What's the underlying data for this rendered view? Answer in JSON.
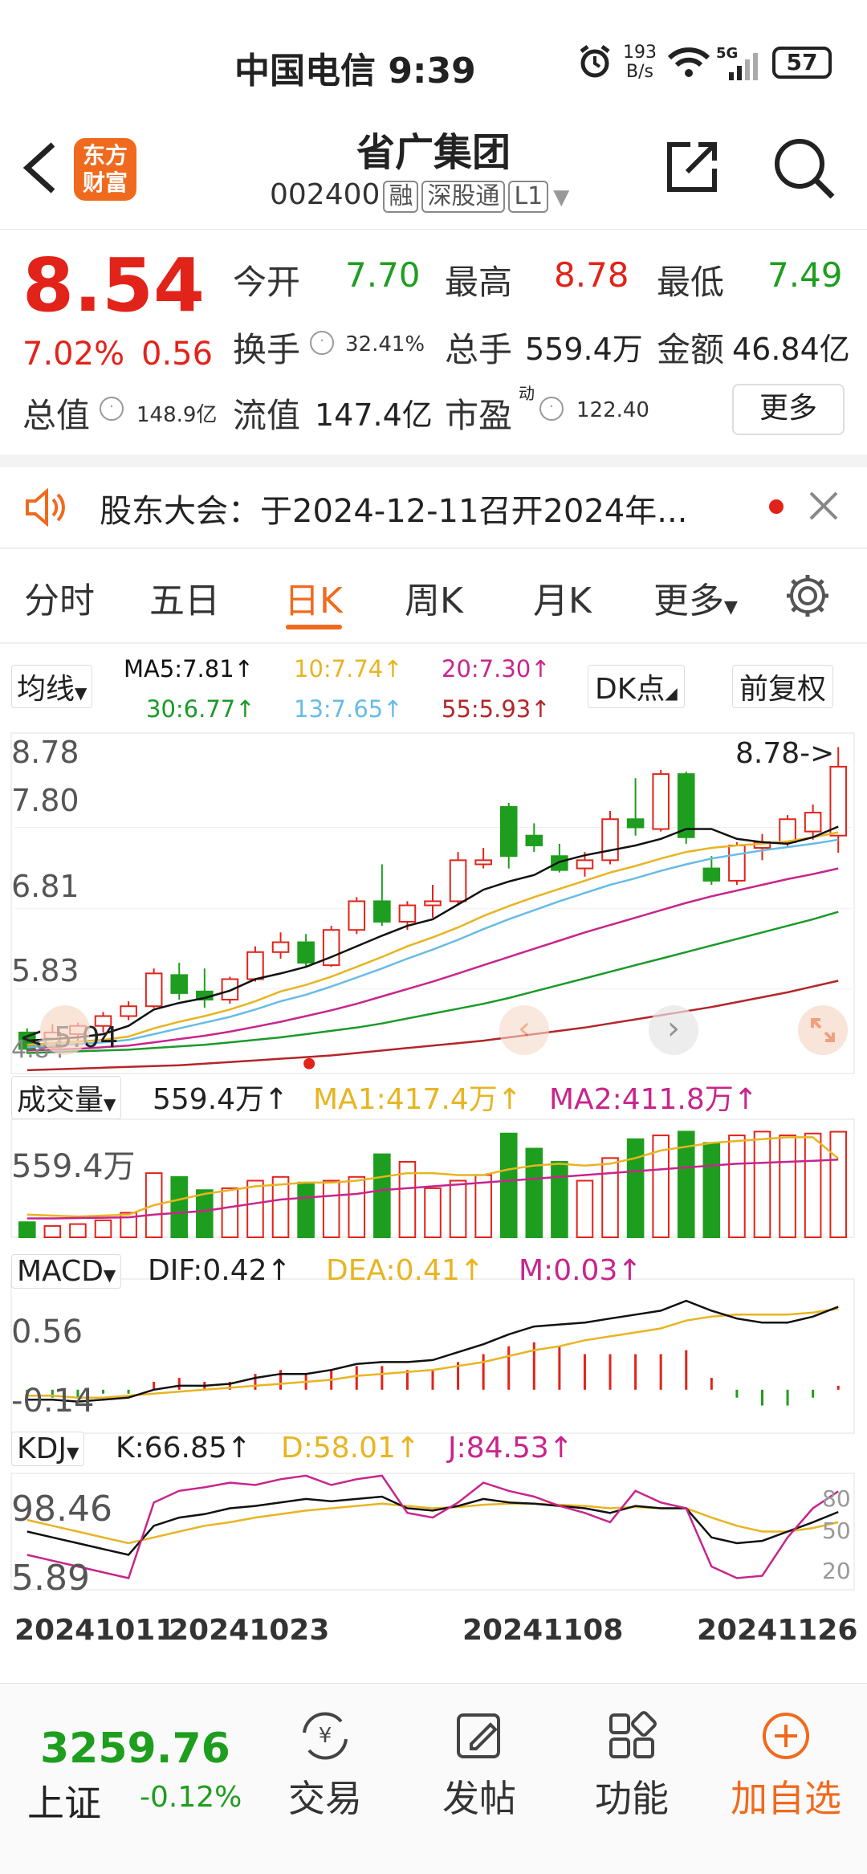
{
  "status_bar": {
    "carrier_time": "中国电信 9:39",
    "net_speed_top": "193",
    "net_speed_unit": "B/s",
    "signal_label": "5G",
    "battery": "57"
  },
  "header": {
    "title": "省广集团",
    "code": "002400",
    "tags": [
      "融",
      "深股通",
      "L1"
    ],
    "logo_line1": "东方",
    "logo_line2": "财富"
  },
  "quote": {
    "price": "8.54",
    "change_pct": "7.02%",
    "change_amt": "0.56",
    "open_label": "今开",
    "open": "7.70",
    "high_label": "最高",
    "high": "8.78",
    "low_label": "最低",
    "low": "7.49",
    "turnover_label": "换手",
    "turnover": "32.41%",
    "volume_label": "总手",
    "volume": "559.4万",
    "amount_label": "金额",
    "amount": "46.84亿",
    "mktcap_label": "总值",
    "mktcap": "148.9亿",
    "float_label": "流值",
    "float_cap": "147.4亿",
    "pe_label": "市盈",
    "pe_sup": "动",
    "pe": "122.40",
    "more_label": "更多"
  },
  "notice": {
    "text": "股东大会：于2024-12-11召开2024年..."
  },
  "tabs": {
    "items": [
      "分时",
      "五日",
      "日K",
      "周K",
      "月K",
      "更多"
    ],
    "active": 2
  },
  "ma_legend": {
    "selector": "均线",
    "ma5": "MA5:7.81↑",
    "ma10": "10:7.74↑",
    "ma20": "20:7.30↑",
    "ma30": "30:6.77↑",
    "ma13": "13:7.65↑",
    "ma55": "55:5.93↑",
    "dk_label": "DK点",
    "adjust_label": "前复权"
  },
  "colors": {
    "up": "#e2231a",
    "down": "#1e9e1e",
    "ma5": "#111111",
    "ma10": "#e8b422",
    "ma13": "#66bce6",
    "ma20": "#c8258c",
    "ma30": "#1a9a2a",
    "ma55": "#b3262a",
    "accent": "#f06a1e"
  },
  "price_axis": {
    "labels": [
      "8.78",
      "7.80",
      "6.81",
      "5.83",
      "4.84"
    ],
    "max_marker": "8.78->",
    "min_marker": "<-5.04"
  },
  "volume_panel": {
    "selector": "成交量",
    "current": "559.4万↑",
    "ma1": "MA1:417.4万↑",
    "ma2": "MA2:411.8万↑",
    "axis_label": "559.4万"
  },
  "macd_panel": {
    "selector": "MACD",
    "dif": "DIF:0.42↑",
    "dea": "DEA:0.41↑",
    "m": "M:0.03↑",
    "axis_top": "0.56",
    "axis_bottom": "-0.14"
  },
  "kdj_panel": {
    "selector": "KDJ",
    "k": "K:66.85↑",
    "d": "D:58.01↑",
    "j": "J:84.53↑",
    "axis_top": "98.46",
    "axis_bottom": "5.89",
    "levels": [
      "80",
      "50",
      "20"
    ]
  },
  "dates": [
    "20241011",
    "20241023",
    "20241108",
    "20241126"
  ],
  "bottom_nav": {
    "index_value": "3259.76",
    "index_name": "上证",
    "index_change": "-0.12%",
    "items": [
      "交易",
      "发帖",
      "功能",
      "加自选"
    ]
  },
  "chart_data": {
    "type": "candlestick",
    "candles": [
      {
        "o": 5.3,
        "h": 5.35,
        "l": 5.04,
        "c": 5.1
      },
      {
        "o": 5.12,
        "h": 5.4,
        "l": 5.08,
        "c": 5.3
      },
      {
        "o": 5.28,
        "h": 5.42,
        "l": 5.2,
        "c": 5.38
      },
      {
        "o": 5.38,
        "h": 5.55,
        "l": 5.3,
        "c": 5.5
      },
      {
        "o": 5.5,
        "h": 5.68,
        "l": 5.45,
        "c": 5.62
      },
      {
        "o": 5.62,
        "h": 6.08,
        "l": 5.6,
        "c": 6.02
      },
      {
        "o": 6.0,
        "h": 6.15,
        "l": 5.7,
        "c": 5.78
      },
      {
        "o": 5.8,
        "h": 6.08,
        "l": 5.6,
        "c": 5.7
      },
      {
        "o": 5.7,
        "h": 5.98,
        "l": 5.65,
        "c": 5.95
      },
      {
        "o": 5.95,
        "h": 6.35,
        "l": 5.92,
        "c": 6.28
      },
      {
        "o": 6.28,
        "h": 6.52,
        "l": 6.2,
        "c": 6.4
      },
      {
        "o": 6.4,
        "h": 6.5,
        "l": 6.1,
        "c": 6.15
      },
      {
        "o": 6.12,
        "h": 6.6,
        "l": 6.1,
        "c": 6.55
      },
      {
        "o": 6.55,
        "h": 6.95,
        "l": 6.5,
        "c": 6.9
      },
      {
        "o": 6.9,
        "h": 7.35,
        "l": 6.6,
        "c": 6.65
      },
      {
        "o": 6.65,
        "h": 6.9,
        "l": 6.55,
        "c": 6.85
      },
      {
        "o": 6.85,
        "h": 7.1,
        "l": 6.7,
        "c": 6.9
      },
      {
        "o": 6.9,
        "h": 7.5,
        "l": 6.85,
        "c": 7.4
      },
      {
        "o": 7.35,
        "h": 7.55,
        "l": 7.3,
        "c": 7.4
      },
      {
        "o": 8.05,
        "h": 8.1,
        "l": 7.3,
        "c": 7.45
      },
      {
        "o": 7.7,
        "h": 7.85,
        "l": 7.5,
        "c": 7.58
      },
      {
        "o": 7.45,
        "h": 7.6,
        "l": 7.25,
        "c": 7.28
      },
      {
        "o": 7.3,
        "h": 7.5,
        "l": 7.2,
        "c": 7.4
      },
      {
        "o": 7.4,
        "h": 8.0,
        "l": 7.35,
        "c": 7.9
      },
      {
        "o": 7.9,
        "h": 8.4,
        "l": 7.7,
        "c": 7.8
      },
      {
        "o": 7.78,
        "h": 8.5,
        "l": 7.75,
        "c": 8.45
      },
      {
        "o": 8.45,
        "h": 8.48,
        "l": 7.6,
        "c": 7.68
      },
      {
        "o": 7.3,
        "h": 7.45,
        "l": 7.1,
        "c": 7.15
      },
      {
        "o": 7.15,
        "h": 7.62,
        "l": 7.1,
        "c": 7.58
      },
      {
        "o": 7.55,
        "h": 7.72,
        "l": 7.4,
        "c": 7.62
      },
      {
        "o": 7.62,
        "h": 7.95,
        "l": 7.55,
        "c": 7.9
      },
      {
        "o": 7.75,
        "h": 8.08,
        "l": 7.65,
        "c": 7.98
      },
      {
        "o": 7.7,
        "h": 8.78,
        "l": 7.49,
        "c": 8.54
      }
    ],
    "ma5": [
      5.2,
      5.22,
      5.24,
      5.28,
      5.38,
      5.58,
      5.66,
      5.72,
      5.81,
      5.95,
      6.02,
      6.1,
      6.22,
      6.35,
      6.48,
      6.6,
      6.68,
      6.86,
      7.04,
      7.14,
      7.22,
      7.38,
      7.46,
      7.52,
      7.58,
      7.66,
      7.78,
      7.78,
      7.66,
      7.62,
      7.6,
      7.68,
      7.81
    ],
    "ma10": [
      5.15,
      5.17,
      5.19,
      5.21,
      5.25,
      5.35,
      5.43,
      5.5,
      5.58,
      5.68,
      5.8,
      5.88,
      5.98,
      6.1,
      6.22,
      6.35,
      6.46,
      6.58,
      6.72,
      6.84,
      6.95,
      7.05,
      7.15,
      7.25,
      7.33,
      7.42,
      7.5,
      7.55,
      7.58,
      7.6,
      7.63,
      7.68,
      7.74
    ],
    "ma13": [
      5.12,
      5.14,
      5.16,
      5.18,
      5.21,
      5.28,
      5.35,
      5.42,
      5.49,
      5.58,
      5.68,
      5.76,
      5.86,
      5.97,
      6.08,
      6.2,
      6.31,
      6.43,
      6.56,
      6.68,
      6.79,
      6.9,
      7.0,
      7.1,
      7.18,
      7.27,
      7.35,
      7.42,
      7.47,
      7.52,
      7.56,
      7.6,
      7.65
    ],
    "ma20": [
      5.08,
      5.09,
      5.1,
      5.12,
      5.14,
      5.18,
      5.22,
      5.26,
      5.31,
      5.37,
      5.43,
      5.5,
      5.57,
      5.65,
      5.74,
      5.83,
      5.92,
      6.02,
      6.12,
      6.22,
      6.32,
      6.42,
      6.52,
      6.61,
      6.7,
      6.79,
      6.88,
      6.96,
      7.03,
      7.1,
      7.17,
      7.23,
      7.3
    ],
    "ma30": [
      5.05,
      5.06,
      5.07,
      5.08,
      5.09,
      5.11,
      5.13,
      5.15,
      5.18,
      5.21,
      5.24,
      5.28,
      5.32,
      5.36,
      5.41,
      5.47,
      5.53,
      5.59,
      5.65,
      5.72,
      5.8,
      5.88,
      5.96,
      6.04,
      6.12,
      6.2,
      6.28,
      6.36,
      6.44,
      6.52,
      6.6,
      6.68,
      6.77
    ],
    "ma55": [
      4.84,
      4.85,
      4.86,
      4.87,
      4.88,
      4.89,
      4.9,
      4.92,
      4.94,
      4.96,
      4.98,
      5.0,
      5.02,
      5.05,
      5.08,
      5.11,
      5.14,
      5.17,
      5.2,
      5.24,
      5.28,
      5.32,
      5.36,
      5.41,
      5.46,
      5.51,
      5.56,
      5.61,
      5.67,
      5.73,
      5.79,
      5.86,
      5.93
    ],
    "volume": [
      80,
      60,
      70,
      90,
      130,
      340,
      320,
      250,
      260,
      300,
      320,
      290,
      300,
      320,
      440,
      400,
      260,
      300,
      330,
      550,
      470,
      400,
      300,
      420,
      520,
      540,
      560,
      500,
      540,
      560,
      540,
      550,
      559.4
    ],
    "vol_ma1": [
      120,
      115,
      110,
      115,
      120,
      170,
      200,
      230,
      250,
      270,
      280,
      290,
      290,
      300,
      320,
      340,
      340,
      330,
      330,
      360,
      380,
      390,
      380,
      390,
      420,
      460,
      480,
      500,
      510,
      520,
      530,
      530,
      417.4
    ],
    "vol_ma2": [
      100,
      100,
      102,
      104,
      106,
      120,
      130,
      140,
      160,
      180,
      200,
      210,
      220,
      230,
      250,
      260,
      270,
      280,
      290,
      300,
      310,
      320,
      330,
      340,
      350,
      360,
      370,
      380,
      390,
      395,
      400,
      405,
      411.8
    ],
    "macd_dif": [
      -0.05,
      -0.05,
      -0.06,
      -0.05,
      -0.04,
      0.0,
      0.02,
      0.02,
      0.03,
      0.06,
      0.08,
      0.08,
      0.1,
      0.13,
      0.14,
      0.14,
      0.15,
      0.19,
      0.23,
      0.28,
      0.32,
      0.33,
      0.34,
      0.36,
      0.38,
      0.4,
      0.45,
      0.4,
      0.36,
      0.34,
      0.34,
      0.37,
      0.42
    ],
    "macd_dea": [
      -0.03,
      -0.03,
      -0.04,
      -0.04,
      -0.03,
      -0.02,
      -0.01,
      0.0,
      0.01,
      0.02,
      0.03,
      0.04,
      0.05,
      0.07,
      0.08,
      0.09,
      0.1,
      0.12,
      0.14,
      0.17,
      0.2,
      0.22,
      0.25,
      0.27,
      0.29,
      0.31,
      0.35,
      0.37,
      0.38,
      0.38,
      0.38,
      0.39,
      0.41
    ],
    "kdj_k": [
      50,
      45,
      40,
      35,
      30,
      55,
      62,
      65,
      70,
      72,
      75,
      78,
      76,
      78,
      80,
      70,
      68,
      72,
      78,
      75,
      74,
      72,
      70,
      66,
      72,
      70,
      70,
      45,
      40,
      42,
      50,
      58,
      66.85
    ],
    "kdj_d": [
      60,
      55,
      50,
      45,
      40,
      45,
      50,
      55,
      58,
      62,
      65,
      68,
      70,
      72,
      74,
      72,
      70,
      71,
      73,
      74,
      74,
      73,
      72,
      70,
      71,
      70,
      70,
      62,
      55,
      50,
      50,
      53,
      58.01
    ],
    "kdj_j": [
      30,
      25,
      20,
      15,
      10,
      75,
      85,
      88,
      92,
      90,
      95,
      98,
      90,
      95,
      98,
      66,
      62,
      75,
      92,
      85,
      80,
      72,
      66,
      58,
      85,
      75,
      70,
      20,
      10,
      12,
      45,
      70,
      84.53
    ]
  }
}
